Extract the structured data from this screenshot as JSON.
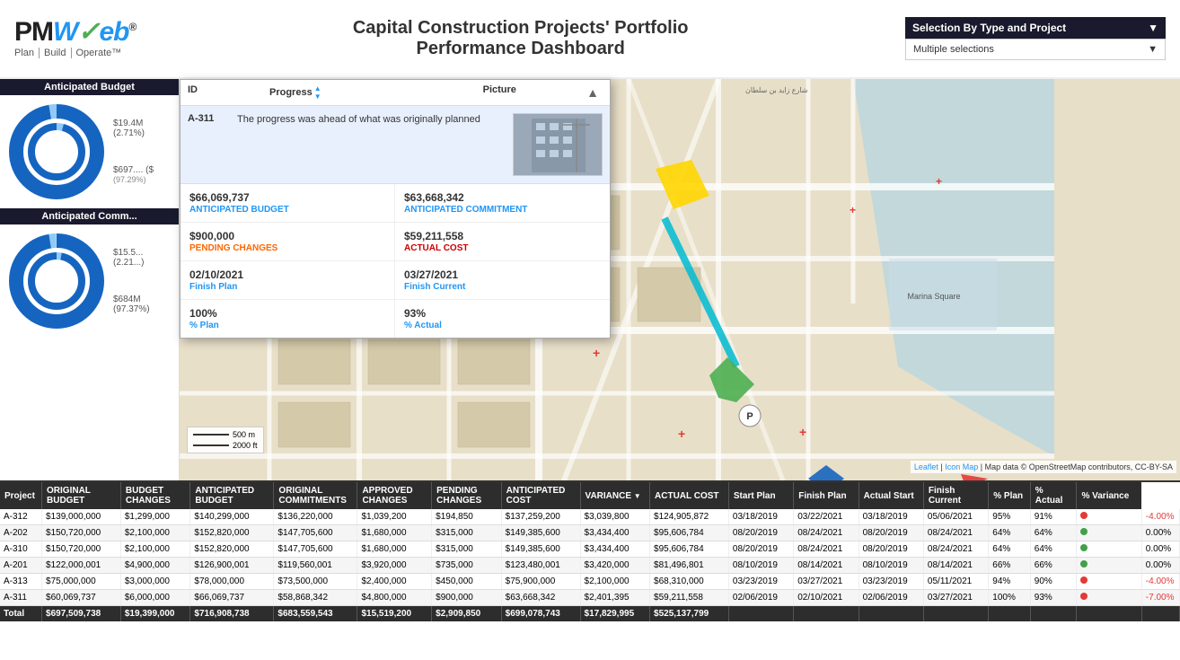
{
  "header": {
    "logo": "PMWeb®",
    "subtitle": "Plan | Build | Operate™",
    "title_line1": "Capital Construction Projects' Portfolio",
    "title_line2": "Performance Dashboard",
    "selection_label": "Selection By Type and Project",
    "selection_value": "Multiple selections"
  },
  "left_panel": {
    "budget_section_title": "Anticipated Budget",
    "budget_top_label": "$19.4M (2.71%)",
    "budget_bottom_label": "$697.... ($",
    "commitment_section_title": "Anticipated Comm...",
    "commitment_top_label": "$15.5... (2.21...)",
    "commitment_bottom_label": "$684M (97.37%)"
  },
  "popup": {
    "col_id": "ID",
    "col_progress": "Progress",
    "col_picture": "Picture",
    "row_id": "A-311",
    "row_progress": "The progress was ahead of what was originally planned",
    "ant_budget_value": "$66,069,737",
    "ant_budget_label": "ANTICIPATED BUDGET",
    "ant_commitment_value": "$63,668,342",
    "ant_commitment_label": "ANTICIPATED COMMITMENT",
    "pending_changes_value": "$900,000",
    "pending_changes_label": "PENDING CHANGES",
    "actual_cost_value": "$59,211,558",
    "actual_cost_label": "ACTUAL COST",
    "finish_plan_date": "02/10/2021",
    "finish_plan_label": "Finish Plan",
    "finish_current_date": "03/27/2021",
    "finish_current_label": "Finish Current",
    "pct_plan_value": "100%",
    "pct_plan_label": "% Plan",
    "pct_actual_value": "93%",
    "pct_actual_label": "% Actual"
  },
  "map": {
    "scale_500m": "500 m",
    "scale_2000ft": "2000 ft",
    "leaflet_link": "Leaflet",
    "icon_map": "Icon Map",
    "attribution": "Map data © OpenStreetMap contributors, CC-BY-SA"
  },
  "table": {
    "headers": [
      "Project",
      "ORIGINAL BUDGET",
      "BUDGET CHANGES",
      "ANTICIPATED BUDGET",
      "ORIGINAL COMMITMENTS",
      "APPROVED CHANGES",
      "PENDING CHANGES",
      "ANTICIPATED COST",
      "VARIANCE",
      "ACTUAL COST",
      "Start Plan",
      "Finish Plan",
      "Actual Start",
      "Finish Current",
      "% Plan",
      "% Actual",
      "% Variance"
    ],
    "rows": [
      [
        "A-312",
        "$139,000,000",
        "$1,299,000",
        "$140,299,000",
        "$136,220,000",
        "$1,039,200",
        "$194,850",
        "$137,259,200",
        "$3,039,800",
        "$124,905,872",
        "03/18/2019",
        "03/22/2021",
        "03/18/2019",
        "05/06/2021",
        "95%",
        "91%",
        "red",
        "-4.00%"
      ],
      [
        "A-202",
        "$150,720,000",
        "$2,100,000",
        "$152,820,000",
        "$147,705,600",
        "$1,680,000",
        "$315,000",
        "$149,385,600",
        "$3,434,400",
        "$95,606,784",
        "08/20/2019",
        "08/24/2021",
        "08/20/2019",
        "08/24/2021",
        "64%",
        "64%",
        "green",
        "0.00%"
      ],
      [
        "A-310",
        "$150,720,000",
        "$2,100,000",
        "$152,820,000",
        "$147,705,600",
        "$1,680,000",
        "$315,000",
        "$149,385,600",
        "$3,434,400",
        "$95,606,784",
        "08/20/2019",
        "08/24/2021",
        "08/20/2019",
        "08/24/2021",
        "64%",
        "64%",
        "green",
        "0.00%"
      ],
      [
        "A-201",
        "$122,000,001",
        "$4,900,000",
        "$126,900,001",
        "$119,560,001",
        "$3,920,000",
        "$735,000",
        "$123,480,001",
        "$3,420,000",
        "$81,496,801",
        "08/10/2019",
        "08/14/2021",
        "08/10/2019",
        "08/14/2021",
        "66%",
        "66%",
        "green",
        "0.00%"
      ],
      [
        "A-313",
        "$75,000,000",
        "$3,000,000",
        "$78,000,000",
        "$73,500,000",
        "$2,400,000",
        "$450,000",
        "$75,900,000",
        "$2,100,000",
        "$68,310,000",
        "03/23/2019",
        "03/27/2021",
        "03/23/2019",
        "05/11/2021",
        "94%",
        "90%",
        "red",
        "-4.00%"
      ],
      [
        "A-311",
        "$60,069,737",
        "$6,000,000",
        "$66,069,737",
        "$58,868,342",
        "$4,800,000",
        "$900,000",
        "$63,668,342",
        "$2,401,395",
        "$59,211,558",
        "02/06/2019",
        "02/10/2021",
        "02/06/2019",
        "03/27/2021",
        "100%",
        "93%",
        "red",
        "-7.00%"
      ]
    ],
    "total_row": [
      "Total",
      "$697,509,738",
      "$19,399,000",
      "$716,908,738",
      "$683,559,543",
      "$15,519,200",
      "$2,909,850",
      "$699,078,743",
      "$17,829,995",
      "$525,137,799",
      "",
      "",
      "",
      "",
      "",
      "",
      "",
      ""
    ]
  }
}
